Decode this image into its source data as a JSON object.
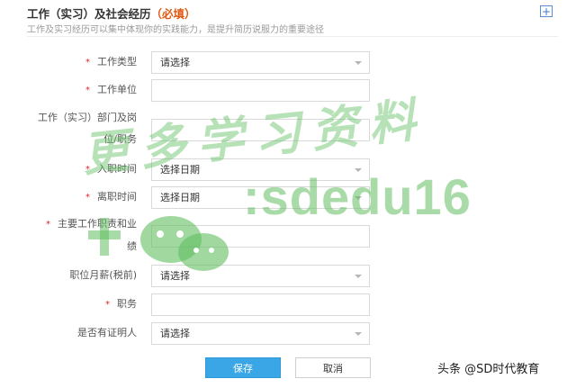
{
  "header": {
    "title": "工作（实习）及社会经历",
    "required_tag": "（必填）",
    "subtitle": "工作及实习经历可以集中体现你的实践能力，是提升简历说服力的重要途径",
    "add_symbol": "+"
  },
  "form": {
    "fields": [
      {
        "label": "工作类型",
        "required": true,
        "type": "select",
        "value": "请选择"
      },
      {
        "label": "工作单位",
        "required": true,
        "type": "input",
        "value": ""
      },
      {
        "label_line1": "工作（实习）部门及岗",
        "label_line2": "位/职务",
        "required": false,
        "type": "input",
        "value": ""
      },
      {
        "label": "入职时间",
        "required": true,
        "type": "select",
        "value": "选择日期"
      },
      {
        "label": "离职时间",
        "required": true,
        "type": "select",
        "value": "选择日期"
      },
      {
        "label_line1": "主要工作职责和业",
        "label_line2": "绩",
        "required": true,
        "type": "input",
        "value": ""
      },
      {
        "label": "职位月薪(税前)",
        "required": false,
        "type": "select",
        "value": "请选择"
      },
      {
        "label": "职务",
        "required": true,
        "type": "input",
        "value": ""
      },
      {
        "label": "是否有证明人",
        "required": false,
        "type": "select",
        "value": "请选择"
      }
    ],
    "required_mark": "*"
  },
  "actions": {
    "save_label": "保存",
    "cancel_label": "取消"
  },
  "watermark": {
    "chinese": "更多学习资料",
    "latin": ":sdedu16"
  },
  "brand": {
    "text": "头条 @SD时代教育"
  },
  "colors": {
    "accent": "#3aa6e6",
    "required": "#d9262a",
    "title_required": "#e05a14",
    "watermark": "#60be60"
  }
}
